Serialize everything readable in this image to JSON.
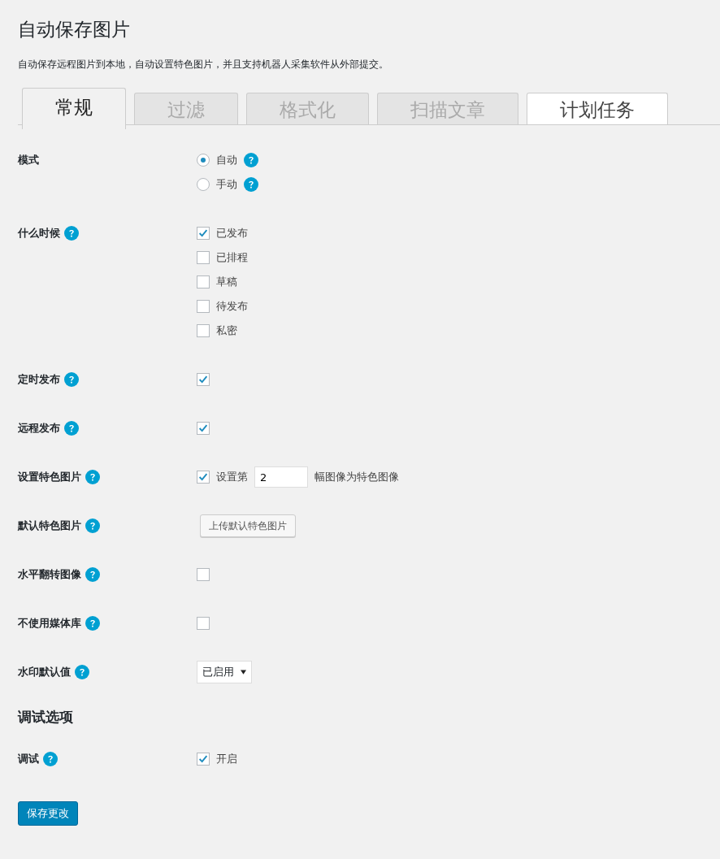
{
  "page": {
    "title": "自动保存图片",
    "description": "自动保存远程图片到本地，自动设置特色图片，并且支持机器人采集软件从外部提交。"
  },
  "tabs": [
    {
      "label": "常规",
      "selected": true,
      "disabled": false
    },
    {
      "label": "过滤",
      "selected": false,
      "disabled": true
    },
    {
      "label": "格式化",
      "selected": false,
      "disabled": true
    },
    {
      "label": "扫描文章",
      "selected": false,
      "disabled": true
    },
    {
      "label": "计划任务",
      "selected": false,
      "disabled": false
    }
  ],
  "settings": [
    {
      "label": "模式",
      "help": false,
      "kind": "radio",
      "options": [
        {
          "label": "自动",
          "selected": true,
          "help": true
        },
        {
          "label": "手动",
          "selected": false,
          "help": true
        }
      ]
    },
    {
      "label": "什么时候",
      "help": true,
      "kind": "checklist",
      "options": [
        {
          "label": "已发布",
          "checked": true
        },
        {
          "label": "已排程",
          "checked": false
        },
        {
          "label": "草稿",
          "checked": false
        },
        {
          "label": "待发布",
          "checked": false
        },
        {
          "label": "私密",
          "checked": false
        }
      ]
    },
    {
      "label": "定时发布",
      "help": true,
      "kind": "checkbox",
      "checked": true
    },
    {
      "label": "远程发布",
      "help": true,
      "kind": "checkbox",
      "checked": true
    },
    {
      "label": "设置特色图片",
      "help": true,
      "kind": "featured",
      "checked": true,
      "before": "设置第",
      "value": "2",
      "after": "幅图像为特色图像"
    },
    {
      "label": "默认特色图片",
      "help": true,
      "kind": "button",
      "button": "上传默认特色图片"
    },
    {
      "label": "水平翻转图像",
      "help": true,
      "kind": "checkbox",
      "checked": false
    },
    {
      "label": "不使用媒体库",
      "help": true,
      "kind": "checkbox",
      "checked": false
    },
    {
      "label": "水印默认值",
      "help": true,
      "kind": "select",
      "value": "已启用"
    }
  ],
  "debug": {
    "heading": "调试选项",
    "settings": [
      {
        "label": "调试",
        "help": true,
        "kind": "checklist",
        "options": [
          {
            "label": "开启",
            "checked": true
          }
        ]
      }
    ]
  },
  "save_button": "保存更改"
}
